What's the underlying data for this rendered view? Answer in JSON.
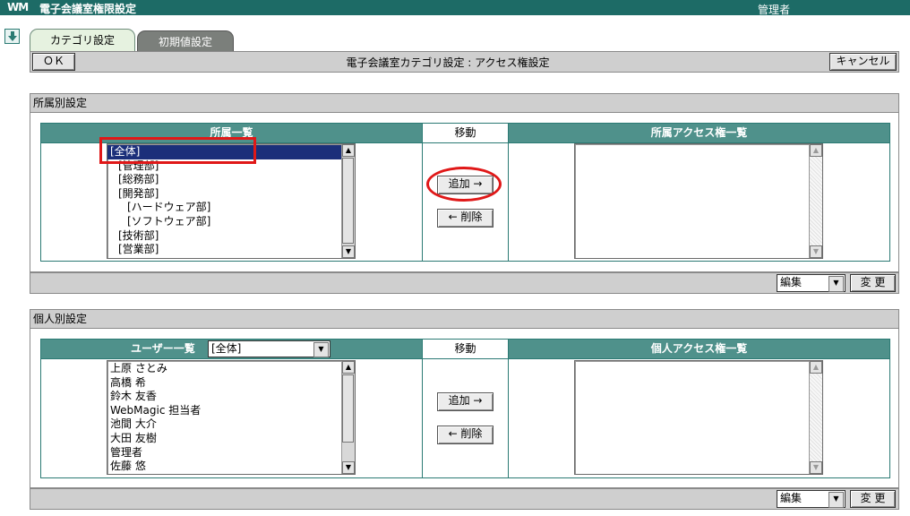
{
  "app": {
    "logo": "WM",
    "title": "電子会議室権限設定",
    "user": "管理者"
  },
  "tabs": [
    {
      "label": "カテゴリ設定"
    },
    {
      "label": "初期値設定"
    }
  ],
  "actionbar": {
    "ok": "ＯＫ",
    "label": "電子会議室カテゴリ設定 : アクセス権設定",
    "cancel": "キャンセル"
  },
  "section1": {
    "title": "所属別設定",
    "left_header": "所属一覧",
    "move_header": "移動",
    "right_header": "所属アクセス権一覧",
    "items": [
      "[全体]",
      "[管理部]",
      "[総務部]",
      "[開発部]",
      "[ハードウェア部]",
      "[ソフトウェア部]",
      "[技術部]",
      "[営業部]"
    ],
    "add": "追加 →",
    "remove": "← 削除",
    "mode": "編集",
    "change": "変 更"
  },
  "section2": {
    "title": "個人別設定",
    "left_header": "ユーザー一覧",
    "filter": "[全体]",
    "move_header": "移動",
    "right_header": "個人アクセス権一覧",
    "items": [
      "上原 さとみ",
      "高橋 希",
      "鈴木 友香",
      "WebMagic 担当者",
      "池間 大介",
      "大田 友樹",
      "管理者",
      "佐藤 悠"
    ],
    "add": "追加 →",
    "remove": "← 削除",
    "mode": "編集",
    "change": "変 更"
  }
}
